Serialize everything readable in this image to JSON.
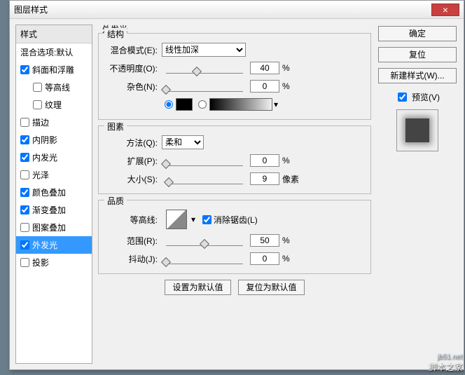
{
  "title": "图层样式",
  "sidebar": {
    "header": "样式",
    "blend_defaults": "混合选项:默认",
    "items": [
      {
        "label": "斜面和浮雕",
        "checked": true
      },
      {
        "label": "等高线",
        "checked": false,
        "sub": true
      },
      {
        "label": "纹理",
        "checked": false,
        "sub": true
      },
      {
        "label": "描边",
        "checked": false
      },
      {
        "label": "内阴影",
        "checked": true
      },
      {
        "label": "内发光",
        "checked": true
      },
      {
        "label": "光泽",
        "checked": false
      },
      {
        "label": "颜色叠加",
        "checked": true
      },
      {
        "label": "渐变叠加",
        "checked": true
      },
      {
        "label": "图案叠加",
        "checked": false
      },
      {
        "label": "外发光",
        "checked": true,
        "selected": true
      },
      {
        "label": "投影",
        "checked": false
      }
    ]
  },
  "buttons": {
    "ok": "确定",
    "reset": "复位",
    "new_style": "新建样式(W)...",
    "preview": "预览(V)",
    "set_default": "设置为默认值",
    "reset_default": "复位为默认值"
  },
  "panel": {
    "title": "外发光",
    "group1": {
      "legend": "结构",
      "blend_mode_label": "混合模式(E):",
      "blend_mode_value": "线性加深",
      "opacity_label": "不透明度(O):",
      "opacity_value": "40",
      "opacity_unit": "%",
      "noise_label": "杂色(N):",
      "noise_value": "0",
      "noise_unit": "%"
    },
    "group2": {
      "legend": "图素",
      "technique_label": "方法(Q):",
      "technique_value": "柔和",
      "spread_label": "扩展(P):",
      "spread_value": "0",
      "spread_unit": "%",
      "size_label": "大小(S):",
      "size_value": "9",
      "size_unit": "像素"
    },
    "group3": {
      "legend": "品质",
      "contour_label": "等高线:",
      "antialias_label": "消除锯齿(L)",
      "range_label": "范围(R):",
      "range_value": "50",
      "range_unit": "%",
      "jitter_label": "抖动(J):",
      "jitter_value": "0",
      "jitter_unit": "%"
    }
  },
  "watermark": {
    "url": "jb51.net",
    "text": "脚本之家"
  }
}
